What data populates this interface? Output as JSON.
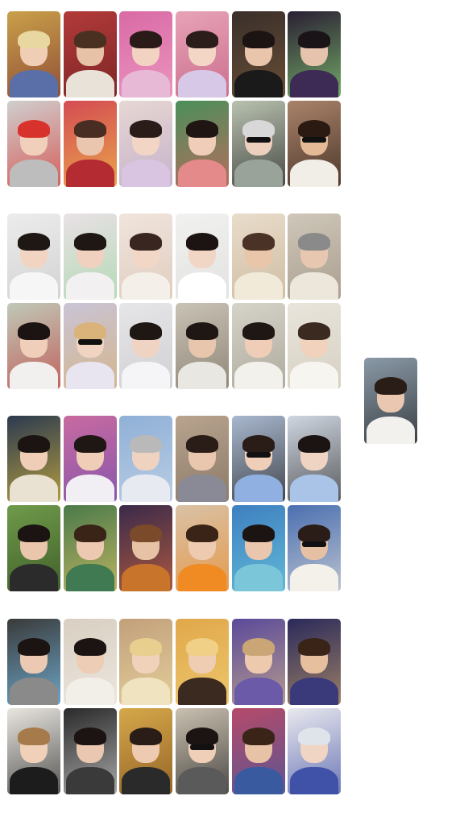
{
  "page": {
    "background": "#ffffff"
  },
  "photocards": [
    {
      "group": 1,
      "row": 1,
      "col": 1,
      "bg": "#c9a04a",
      "accent": "#7a2f2f",
      "hair": "#e8d7a0",
      "skin": "#f0cdb5",
      "top": "#5a6fa8"
    },
    {
      "group": 1,
      "row": 1,
      "col": 2,
      "bg": "#b23a3a",
      "accent": "#6b1e1e",
      "hair": "#4a3020",
      "skin": "#e7c2a6",
      "top": "#e9e2d8"
    },
    {
      "group": 1,
      "row": 1,
      "col": 3,
      "bg": "#d96aa5",
      "accent": "#f2a6c9",
      "hair": "#2a1a18",
      "skin": "#f2d2c0",
      "top": "#e7b9d6"
    },
    {
      "group": 1,
      "row": 1,
      "col": 4,
      "bg": "#e7a3b7",
      "accent": "#c15a7e",
      "hair": "#2b1d1a",
      "skin": "#f3d6c6",
      "top": "#d8c8e8"
    },
    {
      "group": 1,
      "row": 1,
      "col": 5,
      "bg": "#3a2f2a",
      "accent": "#7a5a3a",
      "hair": "#1c1412",
      "skin": "#e9c5ac",
      "top": "#1a1a1a"
    },
    {
      "group": 1,
      "row": 1,
      "col": 6,
      "bg": "#2a1f33",
      "accent": "#8fe07a",
      "hair": "#1a1418",
      "skin": "#e6c3ad",
      "top": "#3d2a55"
    },
    {
      "group": 1,
      "row": 2,
      "col": 1,
      "bg": "#cfcfcf",
      "accent": "#d8322c",
      "hair": "#d8322c",
      "skin": "#f1d0bb",
      "top": "#bdbdbd"
    },
    {
      "group": 1,
      "row": 2,
      "col": 2,
      "bg": "#d44b52",
      "accent": "#f2c84b",
      "hair": "#4a2d22",
      "skin": "#eac6ae",
      "top": "#b42c32"
    },
    {
      "group": 1,
      "row": 2,
      "col": 3,
      "bg": "#e7d7d2",
      "accent": "#b9a3c9",
      "hair": "#2a1c18",
      "skin": "#f2d5c4",
      "top": "#d9c5e2"
    },
    {
      "group": 1,
      "row": 2,
      "col": 4,
      "bg": "#4a8f5a",
      "accent": "#e06060",
      "hair": "#1f1614",
      "skin": "#efcdb8",
      "top": "#e48a8a"
    },
    {
      "group": 1,
      "row": 2,
      "col": 5,
      "bg": "#b9c2b0",
      "accent": "#1b1b1b",
      "hair": "#d8d8d8",
      "skin": "#ecd0bd",
      "top": "#9aa39a",
      "shades": true
    },
    {
      "group": 1,
      "row": 2,
      "col": 6,
      "bg": "#a9836a",
      "accent": "#2a1a12",
      "hair": "#2a1a12",
      "skin": "#e4b996",
      "top": "#f1eee8",
      "shades": true
    },
    {
      "group": 2,
      "row": 1,
      "col": 1,
      "bg": "#ececec",
      "accent": "#c9c9c9",
      "hair": "#1f1714",
      "skin": "#f1d4c2",
      "top": "#f6f6f6"
    },
    {
      "group": 2,
      "row": 1,
      "col": 2,
      "bg": "#e9e0e6",
      "accent": "#9fd8a0",
      "hair": "#1f1714",
      "skin": "#f0d1bf",
      "top": "#f3f0f2"
    },
    {
      "group": 2,
      "row": 1,
      "col": 3,
      "bg": "#f0e4dc",
      "accent": "#d9c4b4",
      "hair": "#3a2620",
      "skin": "#f2d6c6",
      "top": "#f5efe9"
    },
    {
      "group": 2,
      "row": 1,
      "col": 4,
      "bg": "#f1f1ef",
      "accent": "#dcdcda",
      "hair": "#1c1412",
      "skin": "#f1d6c5",
      "top": "#ffffff"
    },
    {
      "group": 2,
      "row": 1,
      "col": 5,
      "bg": "#e8dccb",
      "accent": "#c7b293",
      "hair": "#4a3226",
      "skin": "#e9c6a9",
      "top": "#f1ead9"
    },
    {
      "group": 2,
      "row": 1,
      "col": 6,
      "bg": "#cfc7b9",
      "accent": "#9a8f80",
      "hair": "#8a8a8a",
      "skin": "#e8c7b0",
      "top": "#ece6db"
    },
    {
      "group": 2,
      "row": 2,
      "col": 1,
      "bg": "#bfc9b8",
      "accent": "#c23a3a",
      "hair": "#1c1412",
      "skin": "#efcfb9",
      "top": "#f2f0ee"
    },
    {
      "group": 2,
      "row": 2,
      "col": 2,
      "bg": "#c9c4d6",
      "accent": "#d8b070",
      "hair": "#d9b37a",
      "skin": "#f0d3c0",
      "top": "#e8e4f0",
      "shades": true
    },
    {
      "group": 2,
      "row": 2,
      "col": 3,
      "bg": "#e6e6e8",
      "accent": "#c8c8cc",
      "hair": "#1f1714",
      "skin": "#f0d4c3",
      "top": "#f5f5f7"
    },
    {
      "group": 2,
      "row": 2,
      "col": 4,
      "bg": "#c9c3b5",
      "accent": "#7a6f60",
      "hair": "#1f1714",
      "skin": "#e8c6ae",
      "top": "#e9e7e2"
    },
    {
      "group": 2,
      "row": 2,
      "col": 5,
      "bg": "#d6d3c9",
      "accent": "#9f9a8c",
      "hair": "#1f1714",
      "skin": "#efcdb6",
      "top": "#f3f1ec"
    },
    {
      "group": 2,
      "row": 2,
      "col": 6,
      "bg": "#e9e5dc",
      "accent": "#cfc8b8",
      "hair": "#3a2a20",
      "skin": "#f0d2bd",
      "top": "#f7f5f0"
    },
    {
      "group": 3,
      "row": 1,
      "col": 1,
      "bg": "#2c3a4f",
      "accent": "#e6c23a",
      "hair": "#1c1412",
      "skin": "#efcdb6",
      "top": "#e9e2d2"
    },
    {
      "group": 3,
      "row": 1,
      "col": 2,
      "bg": "#c86aa0",
      "accent": "#6f4fb0",
      "hair": "#1f1714",
      "skin": "#efcdb6",
      "top": "#f1eef4"
    },
    {
      "group": 3,
      "row": 1,
      "col": 3,
      "bg": "#8fb0d6",
      "accent": "#c9d9ea",
      "hair": "#b9b9b9",
      "skin": "#efd2bf",
      "top": "#e7eaf0"
    },
    {
      "group": 3,
      "row": 1,
      "col": 4,
      "bg": "#b8a48f",
      "accent": "#7a6a58",
      "hair": "#2a1c16",
      "skin": "#e9c7ae",
      "top": "#8a8a96"
    },
    {
      "group": 3,
      "row": 1,
      "col": 5,
      "bg": "#a9b8cf",
      "accent": "#1b1b1b",
      "hair": "#2a1c16",
      "skin": "#efcfb9",
      "top": "#8fb0e0",
      "shades": true
    },
    {
      "group": 3,
      "row": 1,
      "col": 6,
      "bg": "#cfd6e0",
      "accent": "#2a2a2a",
      "hair": "#1c1412",
      "skin": "#f0d4c3",
      "top": "#a9c4e6"
    },
    {
      "group": 3,
      "row": 2,
      "col": 1,
      "bg": "#6f9a4a",
      "accent": "#2f4a1e",
      "hair": "#1c1412",
      "skin": "#e9c6ac",
      "top": "#2b2b2b"
    },
    {
      "group": 3,
      "row": 2,
      "col": 2,
      "bg": "#4a7a4a",
      "accent": "#e8c96a",
      "hair": "#3a2418",
      "skin": "#ecc9b0",
      "top": "#3f7a52"
    },
    {
      "group": 3,
      "row": 2,
      "col": 3,
      "bg": "#3a2a4a",
      "accent": "#d86a3a",
      "hair": "#7a4a2a",
      "skin": "#e8c2a4",
      "top": "#c8742a"
    },
    {
      "group": 3,
      "row": 2,
      "col": 4,
      "bg": "#d9c2a6",
      "accent": "#e98a2a",
      "hair": "#3a2418",
      "skin": "#eecbb0",
      "top": "#f08a22"
    },
    {
      "group": 3,
      "row": 2,
      "col": 5,
      "bg": "#3e7fc0",
      "accent": "#6fd0e0",
      "hair": "#1c1412",
      "skin": "#e9c6ad",
      "top": "#7bc6d8"
    },
    {
      "group": 3,
      "row": 2,
      "col": 6,
      "bg": "#4a6fb0",
      "accent": "#e9e4dc",
      "hair": "#2a1c16",
      "skin": "#e6c0a2",
      "top": "#f4f1ea",
      "shades": true
    },
    {
      "group": 4,
      "row": 1,
      "col": 1,
      "bg": "#3a3a3a",
      "accent": "#7fd0ff",
      "hair": "#1c1412",
      "skin": "#ecc9b2",
      "top": "#8a8a8a"
    },
    {
      "group": 4,
      "row": 1,
      "col": 2,
      "bg": "#d9cfc2",
      "accent": "#f3efe8",
      "hair": "#1c1412",
      "skin": "#eecdb6",
      "top": "#f2eee8"
    },
    {
      "group": 4,
      "row": 1,
      "col": 3,
      "bg": "#c2a07a",
      "accent": "#f0e0a8",
      "hair": "#e8cf8f",
      "skin": "#f0d2bb",
      "top": "#f0e4c0"
    },
    {
      "group": 4,
      "row": 1,
      "col": 4,
      "bg": "#e0a84a",
      "accent": "#f3d27a",
      "hair": "#f0cf86",
      "skin": "#efcdb3",
      "top": "#3a2a20"
    },
    {
      "group": 4,
      "row": 1,
      "col": 5,
      "bg": "#5a4a9a",
      "accent": "#d9b98a",
      "hair": "#caa676",
      "skin": "#edc9ae",
      "top": "#6a5aa8"
    },
    {
      "group": 4,
      "row": 1,
      "col": 6,
      "bg": "#2a2a5a",
      "accent": "#c9a06a",
      "hair": "#3a2418",
      "skin": "#e6bf9e",
      "top": "#3a3a7a"
    },
    {
      "group": 4,
      "row": 2,
      "col": 1,
      "bg": "#e9e6e0",
      "accent": "#1b1b1b",
      "hair": "#a67a4a",
      "skin": "#f0d0b8",
      "top": "#1c1c1c"
    },
    {
      "group": 4,
      "row": 2,
      "col": 2,
      "bg": "#2a2a2a",
      "accent": "#d8d8d8",
      "hair": "#1c1412",
      "skin": "#e9c7b0",
      "top": "#3a3a3a"
    },
    {
      "group": 4,
      "row": 2,
      "col": 3,
      "bg": "#d6a84a",
      "accent": "#7a4a1a",
      "hair": "#2a1c16",
      "skin": "#eecbb0",
      "top": "#2a2a2a"
    },
    {
      "group": 4,
      "row": 2,
      "col": 4,
      "bg": "#c9c0b0",
      "accent": "#1b1b1b",
      "hair": "#1c1412",
      "skin": "#efcfb8",
      "top": "#5a5a5a",
      "shades": true
    },
    {
      "group": 4,
      "row": 2,
      "col": 5,
      "bg": "#b64a6a",
      "accent": "#3a5aa0",
      "hair": "#3a2418",
      "skin": "#e8c2a6",
      "top": "#3a5aa0"
    },
    {
      "group": 4,
      "row": 2,
      "col": 6,
      "bg": "#e9e9ef",
      "accent": "#3a4aa0",
      "hair": "#dfe3ea",
      "skin": "#f1d5c4",
      "top": "#3f52a8"
    }
  ],
  "extra_card": {
    "bg": "#8a9aa8",
    "accent": "#1b1b1b",
    "hair": "#2a1c16",
    "skin": "#e9c7b0",
    "top": "#f3f1ee"
  }
}
